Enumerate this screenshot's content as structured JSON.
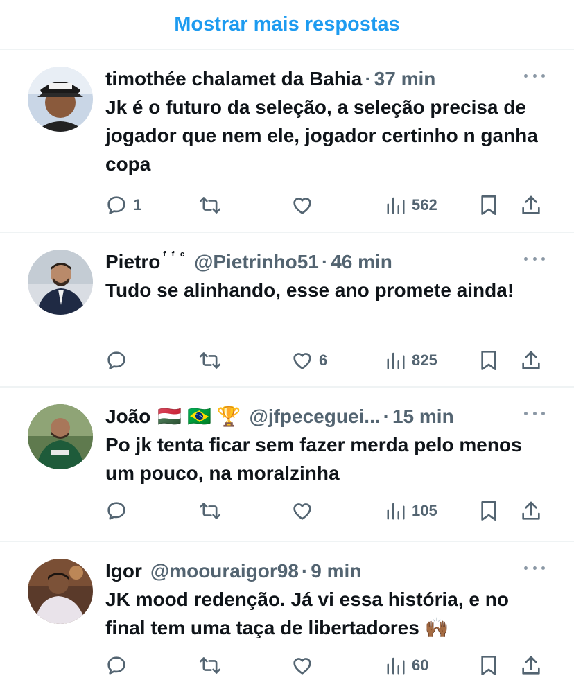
{
  "show_more_label": "Mostrar mais respostas",
  "colors": {
    "accent": "#1d9bf0",
    "text": "#0f1419",
    "muted": "#536471",
    "divider": "#eff3f4"
  },
  "replies": [
    {
      "name": "timothée chalamet da Bahia",
      "badge": "",
      "flags": "",
      "handle": "",
      "dot": "·",
      "time": "37 min",
      "text": "Jk é o futuro da seleção, a seleção precisa de jogador que nem ele, jogador certinho n ganha copa",
      "replies_count": "1",
      "likes": "",
      "views": "562"
    },
    {
      "name": "Pietro",
      "badge": "ᶠ ᶠ ᶜ",
      "flags": "",
      "handle": "@Pietrinho51",
      "dot": "·",
      "time": "46 min",
      "text": "Tudo se alinhando, esse ano promete ainda!",
      "replies_count": "",
      "likes": "6",
      "views": "825"
    },
    {
      "name": "João",
      "badge": "",
      "flags": "🇭🇺 🇧🇷 🏆",
      "handle": "@jfpeceguei...",
      "dot": "·",
      "time": "15 min",
      "text": "Po jk tenta ficar sem fazer merda pelo menos um pouco, na moralzinha",
      "replies_count": "",
      "likes": "",
      "views": "105"
    },
    {
      "name": "Igor",
      "badge": "",
      "flags": "",
      "handle": "@moouraigor98",
      "dot": "·",
      "time": "9 min",
      "text": "JK mood redenção. Já vi essa história, e no final tem uma taça de libertadores 🙌🏾",
      "replies_count": "",
      "likes": "",
      "views": "60"
    }
  ]
}
